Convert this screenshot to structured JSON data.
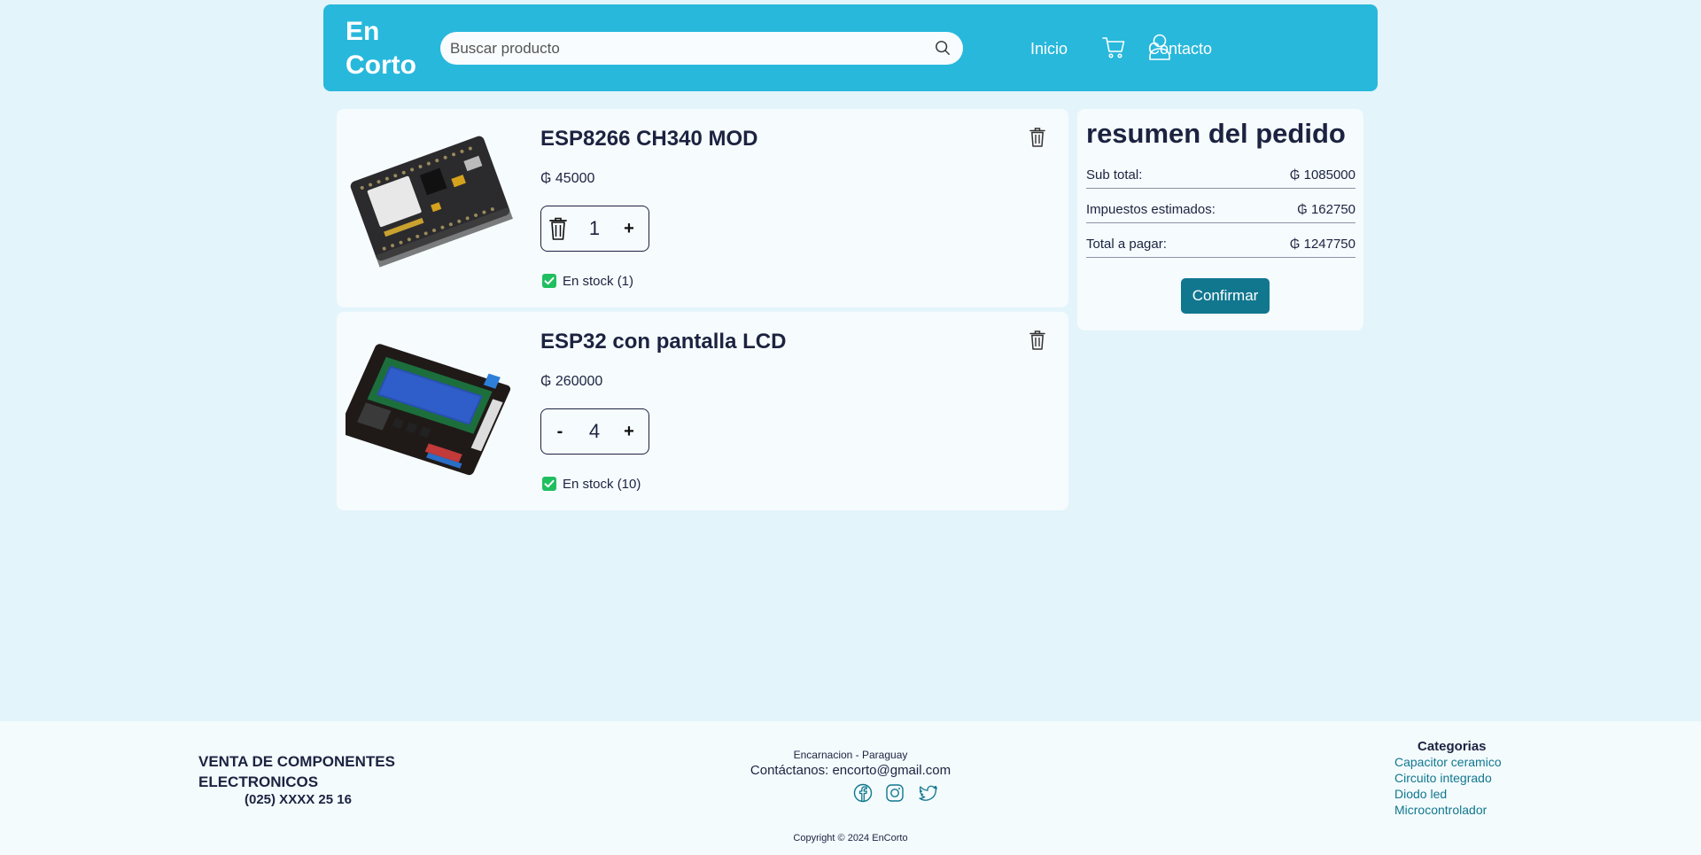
{
  "header": {
    "logo_line1": "En",
    "logo_line2": "Corto",
    "search_placeholder": "Buscar producto",
    "nav": [
      "Inicio",
      "Contacto"
    ]
  },
  "cart": [
    {
      "name": "ESP8266 CH340 MOD",
      "price": "₲ 45000",
      "quantity": "1",
      "minus_symbol": "trash-icon",
      "plus_symbol": "+",
      "stock": "En stock (1)"
    },
    {
      "name": "ESP32 con pantalla LCD",
      "price": "₲ 260000",
      "quantity": "4",
      "minus_symbol": "-",
      "plus_symbol": "+",
      "stock": "En stock (10)"
    }
  ],
  "summary": {
    "title": "resumen del pedido",
    "subtotal_label": "Sub total:",
    "subtotal_value": "₲ 1085000",
    "tax_label": "Impuestos estimados:",
    "tax_value": "₲ 162750",
    "total_label": "Total a pagar:",
    "total_value": "₲ 1247750",
    "confirm_label": "Confirmar"
  },
  "footer": {
    "tagline_line1": "VENTA DE COMPONENTES",
    "tagline_line2": "ELECTRONICOS",
    "phone": "(025) XXXX 25 16",
    "city": "Encarnacion - Paraguay",
    "contact": "Contáctanos: encorto@gmail.com",
    "copyright": "Copyright © 2024 EnCorto",
    "categories_title": "Categorias",
    "categories": [
      "Capacitor ceramico",
      "Circuito integrado",
      "Diodo led",
      "Microcontrolador"
    ]
  },
  "colors": {
    "page_bg": "#e3f4fb",
    "header_bg": "#28b8dc",
    "card_bg": "#f6fbfd",
    "accent": "#11778f",
    "stock_green": "#1fbf5f"
  }
}
